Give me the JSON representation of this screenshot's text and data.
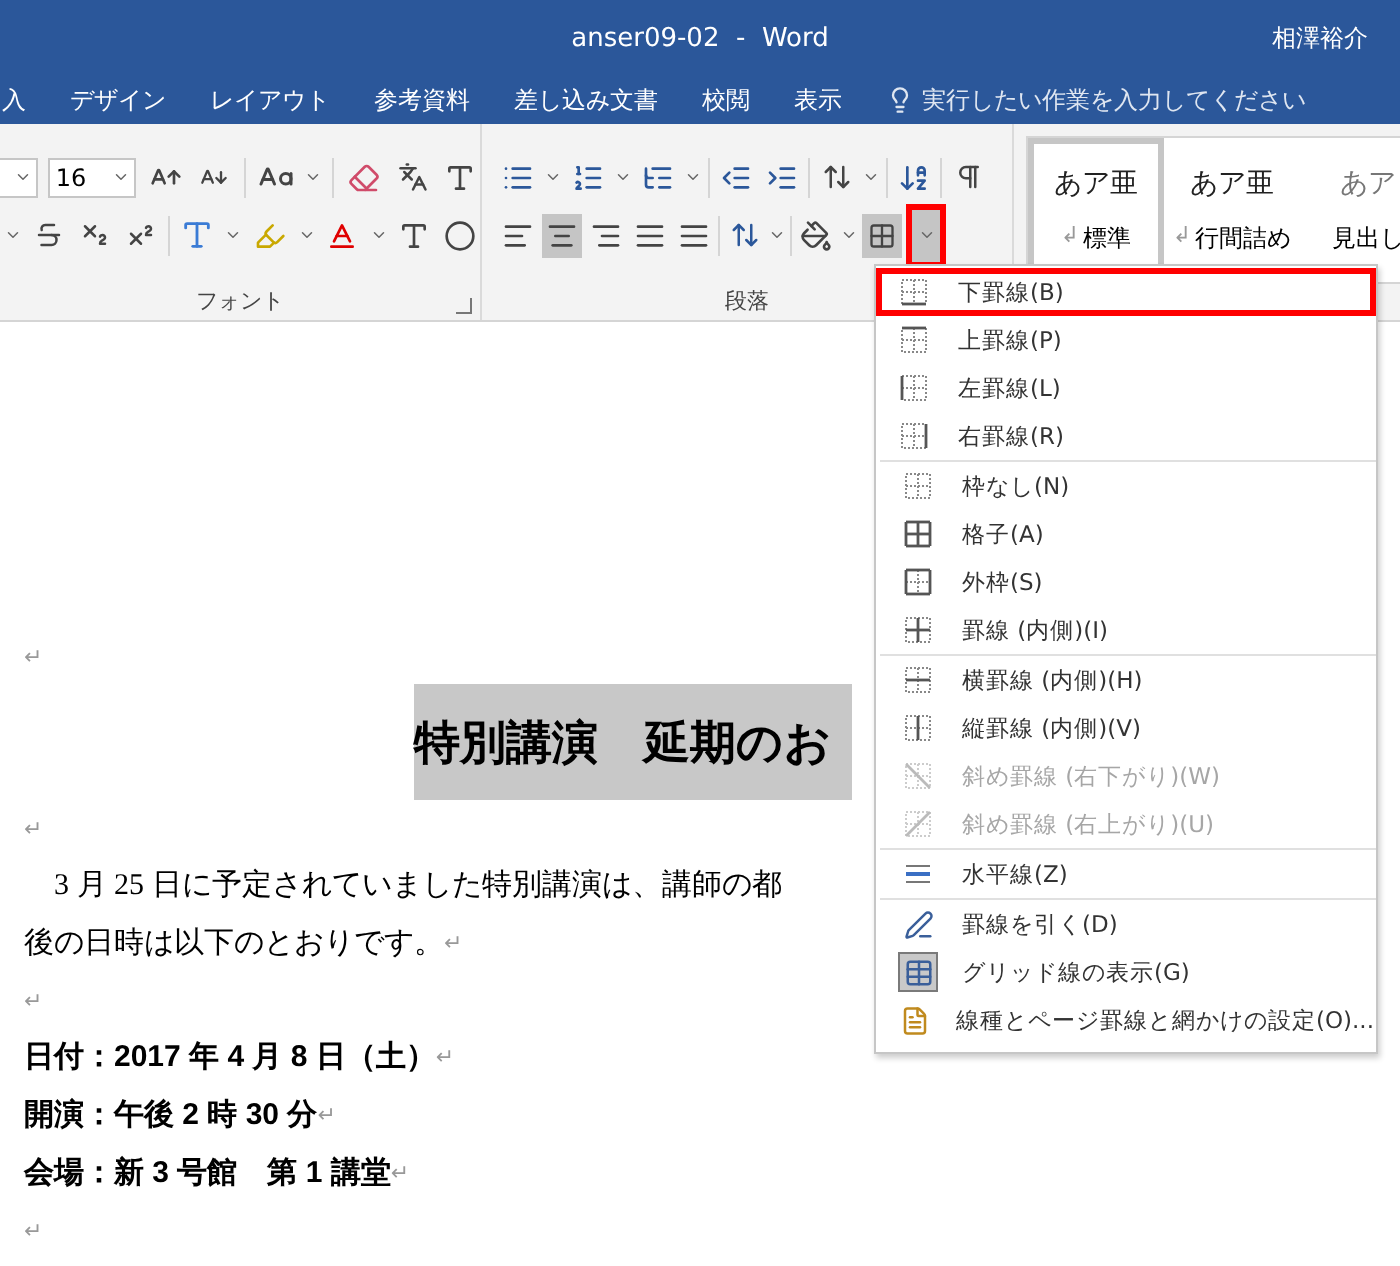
{
  "window": {
    "title": "anser09-02  -  Word",
    "user": "相澤裕介"
  },
  "tabs": [
    "入",
    "デザイン",
    "レイアウト",
    "参考資料",
    "差し込み文書",
    "校閲",
    "表示"
  ],
  "tell_me": {
    "placeholder": "実行したい作業を入力してください"
  },
  "ribbon": {
    "font": {
      "size": "16",
      "label": "フォント"
    },
    "paragraph": {
      "label": "段落",
      "align_buttons": [
        {
          "kind": "left",
          "selected": false
        },
        {
          "kind": "center",
          "selected": true
        },
        {
          "kind": "right",
          "selected": false
        },
        {
          "kind": "justify",
          "selected": false
        },
        {
          "kind": "distributed",
          "selected": false
        }
      ],
      "borders": {
        "selected": true,
        "highlighted": true
      }
    },
    "styles": [
      {
        "sample": "あア亜",
        "mark": "↲",
        "name": "標準",
        "selected": true
      },
      {
        "sample": "あア亜",
        "mark": "↲",
        "name": "行間詰め",
        "selected": false
      },
      {
        "sample": "あア",
        "name": "見出し",
        "selected": false
      }
    ]
  },
  "document": {
    "lines": [
      {
        "kind": "blank",
        "mark": "↵"
      },
      {
        "kind": "title",
        "text": "特別講演　延期のお",
        "highlighted": true
      },
      {
        "kind": "blank",
        "mark": "↵"
      },
      {
        "kind": "body",
        "text": "　3 月 25 日に予定されていました特別講演は、講師の都"
      },
      {
        "kind": "body",
        "text": "後の日時は以下のとおりです。",
        "mark": "↵"
      },
      {
        "kind": "blank",
        "mark": "↵"
      },
      {
        "kind": "bold",
        "text": "日付：2017 年 4 月 8 日（土）",
        "mark": "↵"
      },
      {
        "kind": "bold",
        "text": "開演：午後 2 時 30 分",
        "mark": "↵"
      },
      {
        "kind": "bold",
        "text": "会場：新 3 号館　第 1 講堂",
        "mark": "↵"
      },
      {
        "kind": "blank",
        "mark": "↵"
      }
    ]
  },
  "borders_menu": {
    "groups": [
      [
        {
          "kind": "bottom",
          "label": "下罫線(B)",
          "highlighted": true,
          "disabled": false,
          "checked": false
        },
        {
          "kind": "top",
          "label": "上罫線(P)",
          "highlighted": false,
          "disabled": false,
          "checked": false
        },
        {
          "kind": "left",
          "label": "左罫線(L)",
          "highlighted": false,
          "disabled": false,
          "checked": false
        },
        {
          "kind": "right",
          "label": "右罫線(R)",
          "highlighted": false,
          "disabled": false,
          "checked": false
        }
      ],
      [
        {
          "kind": "none",
          "label": "枠なし(N)",
          "highlighted": false,
          "disabled": false,
          "checked": false
        },
        {
          "kind": "all",
          "label": "格子(A)",
          "highlighted": false,
          "disabled": false,
          "checked": false
        },
        {
          "kind": "outside",
          "label": "外枠(S)",
          "highlighted": false,
          "disabled": false,
          "checked": false
        },
        {
          "kind": "inside",
          "label": "罫線 (内側)(I)",
          "highlighted": false,
          "disabled": false,
          "checked": false
        }
      ],
      [
        {
          "kind": "inside_h",
          "label": "横罫線 (内側)(H)",
          "highlighted": false,
          "disabled": false,
          "checked": false
        },
        {
          "kind": "inside_v",
          "label": "縦罫線 (内側)(V)",
          "highlighted": false,
          "disabled": false,
          "checked": false
        },
        {
          "kind": "diag_down",
          "label": "斜め罫線 (右下がり)(W)",
          "highlighted": false,
          "disabled": true,
          "checked": false
        },
        {
          "kind": "diag_up",
          "label": "斜め罫線 (右上がり)(U)",
          "highlighted": false,
          "disabled": true,
          "checked": false
        }
      ],
      [
        {
          "kind": "hline",
          "label": "水平線(Z)",
          "highlighted": false,
          "disabled": false,
          "checked": false
        }
      ],
      [
        {
          "kind": "draw",
          "label": "罫線を引く(D)",
          "highlighted": false,
          "disabled": false,
          "checked": false
        },
        {
          "kind": "grid",
          "label": "グリッド線の表示(G)",
          "highlighted": false,
          "disabled": false,
          "checked": true
        },
        {
          "kind": "settings",
          "label": "線種とページ罫線と網かけの設定(O)...",
          "highlighted": false,
          "disabled": false,
          "checked": false
        }
      ]
    ]
  }
}
